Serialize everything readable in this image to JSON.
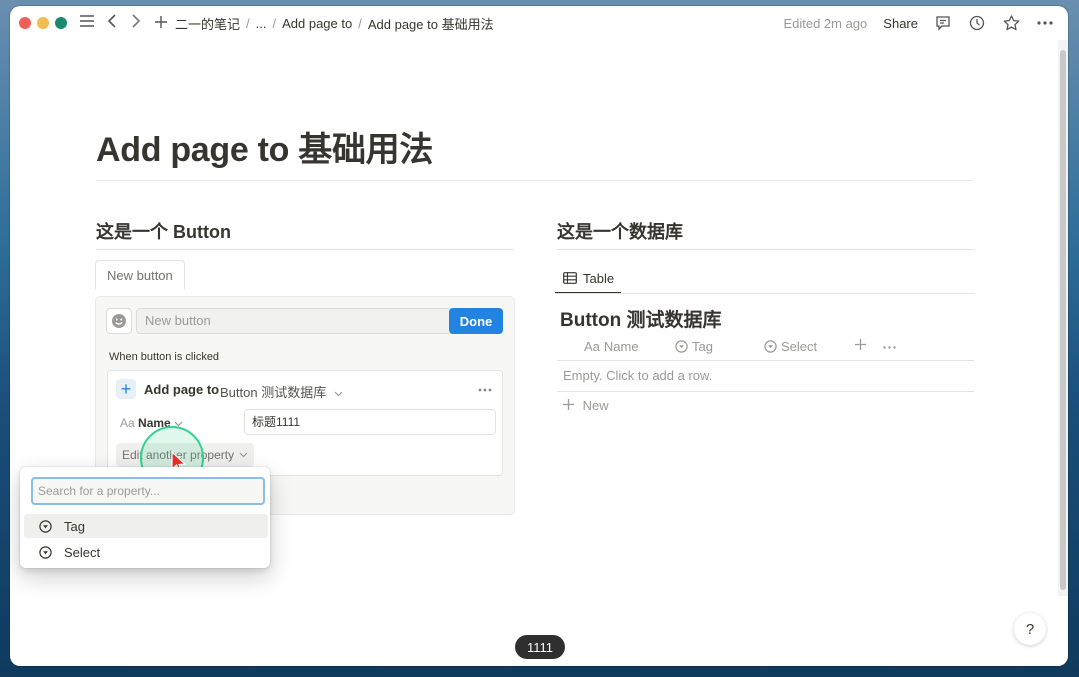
{
  "window": {
    "traffic_colors": [
      "#ee5f57",
      "#f5bd4f",
      "#1a8a6f"
    ]
  },
  "breadcrumb": {
    "items": [
      "二一的笔记",
      "...",
      "Add page to",
      "Add page to 基础用法"
    ],
    "separator": "/"
  },
  "topbar": {
    "edited": "Edited 2m ago",
    "share_label": "Share"
  },
  "page": {
    "title": "Add page to 基础用法"
  },
  "left_section": {
    "heading": "这是一个 Button",
    "tab_label": "New button",
    "name_placeholder": "New button",
    "done_label": "Done",
    "when_label": "When button is clicked",
    "action": {
      "label": "Add page to",
      "target": "Button 测试数据库"
    },
    "prop": {
      "aa": "Aa",
      "name_label": "Name",
      "value": "标题1111"
    },
    "edit_property_label": "Edit another property"
  },
  "popup": {
    "search_placeholder": "Search for a property...",
    "items": [
      {
        "label": "Tag",
        "icon": "select-icon"
      },
      {
        "label": "Select",
        "icon": "select-icon"
      }
    ]
  },
  "right_section": {
    "heading": "这是一个数据库",
    "tab_label": "Table",
    "db_title": "Button 测试数据库",
    "columns": [
      {
        "aa": "Aa",
        "label": "Name"
      },
      {
        "label": "Tag"
      },
      {
        "label": "Select"
      }
    ],
    "empty_text": "Empty. Click to add a row.",
    "new_label": "New"
  },
  "footer": {
    "page_counter": "1111",
    "help_label": "?"
  }
}
